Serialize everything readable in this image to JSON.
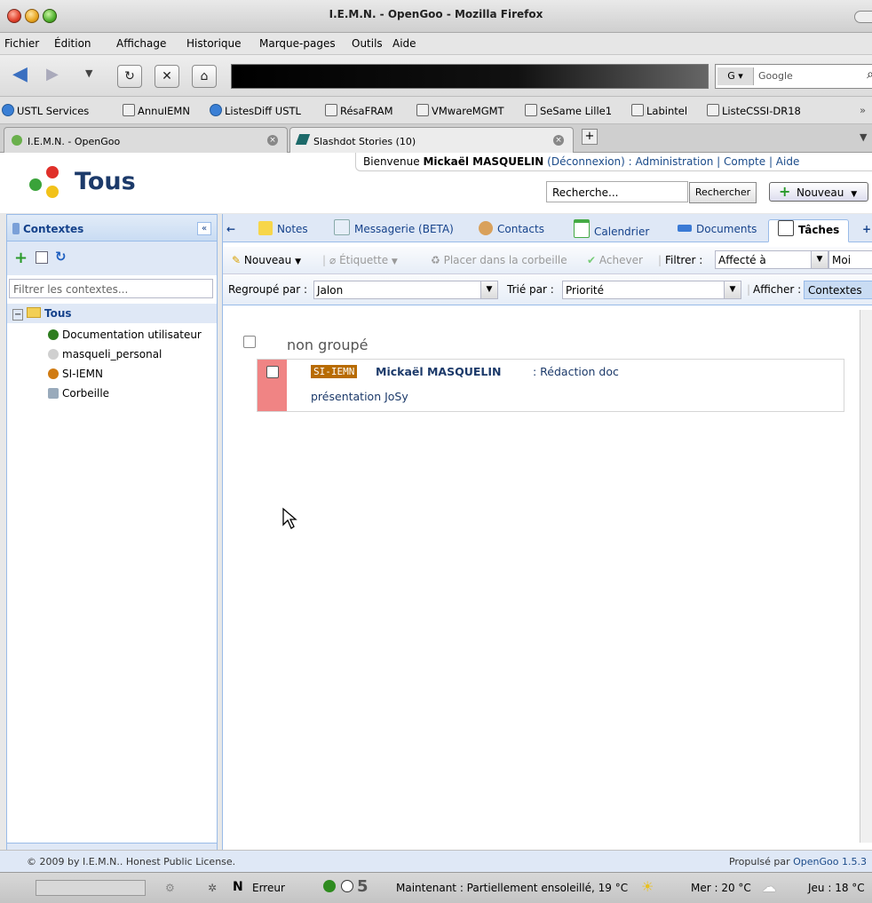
{
  "window": {
    "title": "I.E.M.N. - OpenGoo - Mozilla Firefox"
  },
  "menu": [
    "Fichier",
    "Édition",
    "Affichage",
    "Historique",
    "Marque-pages",
    "Outils",
    "Aide"
  ],
  "search_engine": {
    "placeholder": "Google"
  },
  "bookmarks": [
    "USTL Services",
    "AnnuIEMN",
    "ListesDiff USTL",
    "RésaFRAM",
    "VMwareMGMT",
    "SeSame Lille1",
    "Labintel",
    "ListeCSSI-DR18"
  ],
  "tabs": [
    {
      "label": "I.E.M.N. - OpenGoo"
    },
    {
      "label": "Slashdot Stories (10)"
    }
  ],
  "header": {
    "title": "Tous",
    "welcome_prefix": "Bienvenue",
    "user": "Mickaël MASQUELIN",
    "logout": "(Déconnexion)",
    "admin": "Administration",
    "account": "Compte",
    "help": "Aide",
    "search_value": "Recherche...",
    "search_button": "Rechercher",
    "new_button": "Nouveau"
  },
  "contexts": {
    "title": "Contextes",
    "filter_placeholder": "Filtrer les contextes...",
    "root": "Tous",
    "items": [
      {
        "label": "Documentation utilisateur",
        "color": "#2e7d1f"
      },
      {
        "label": "masqueli_personal",
        "color": "#d0d0d0"
      },
      {
        "label": "SI-IEMN",
        "color": "#d07b12"
      },
      {
        "label": "Corbeille",
        "color": "#9ab"
      }
    ]
  },
  "main_tabs": [
    "Notes",
    "Messagerie (BETA)",
    "Contacts",
    "Calendrier",
    "Documents",
    "Tâches"
  ],
  "toolbar": {
    "new": "Nouveau",
    "tag": "Étiquette",
    "trash": "Placer dans la corbeille",
    "complete": "Achever",
    "filter_label": "Filtrer :",
    "filter_value": "Affecté à",
    "filter_user": "Moi",
    "group_label": "Regroupé par :",
    "group_value": "Jalon",
    "sort_label": "Trié par :",
    "sort_value": "Priorité",
    "show_label": "Afficher :",
    "show_value": "Contextes"
  },
  "tasks": {
    "group_title": "non groupé",
    "items": [
      {
        "context": "SI-IEMN",
        "user": "Mickaël MASQUELIN",
        "title_part1": ": Rédaction doc",
        "title_part2": "présentation JoSy"
      }
    ]
  },
  "footer": {
    "copyright": "© 2009 by I.E.M.N.. Honest Public License.",
    "powered_prefix": "Propulsé par",
    "powered_link": "OpenGoo 1.5.3"
  },
  "status": {
    "error": "Erreur",
    "count": "5",
    "weather_now": "Maintenant : Partiellement ensoleillé, 19 °C",
    "weather_wed": "Mer : 20 °C",
    "weather_thu": "Jeu : 18 °C"
  }
}
